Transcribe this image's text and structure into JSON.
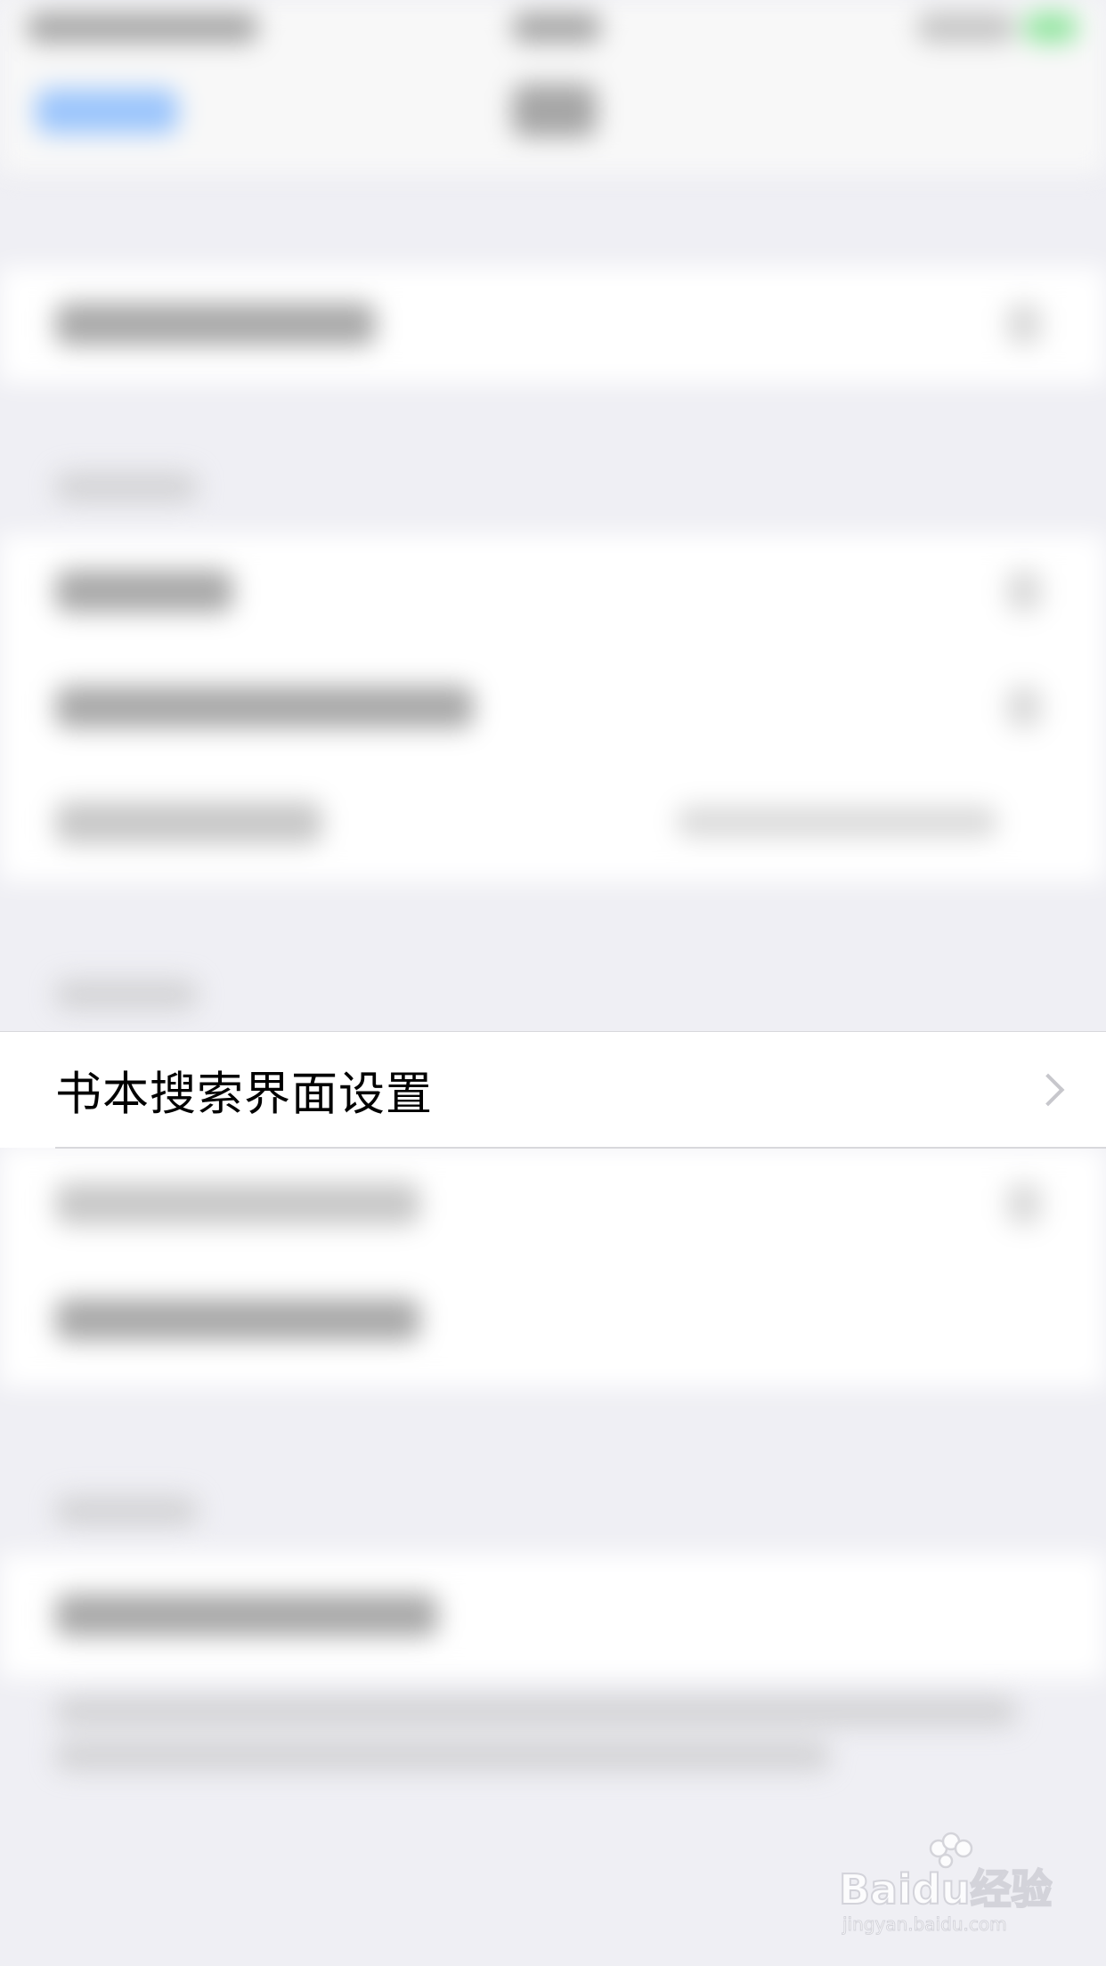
{
  "focused_row": {
    "label": "书本搜索界面设置"
  },
  "watermark": {
    "logo_text": "Baidu经验",
    "url_text": "jingyan.baidu.com"
  }
}
